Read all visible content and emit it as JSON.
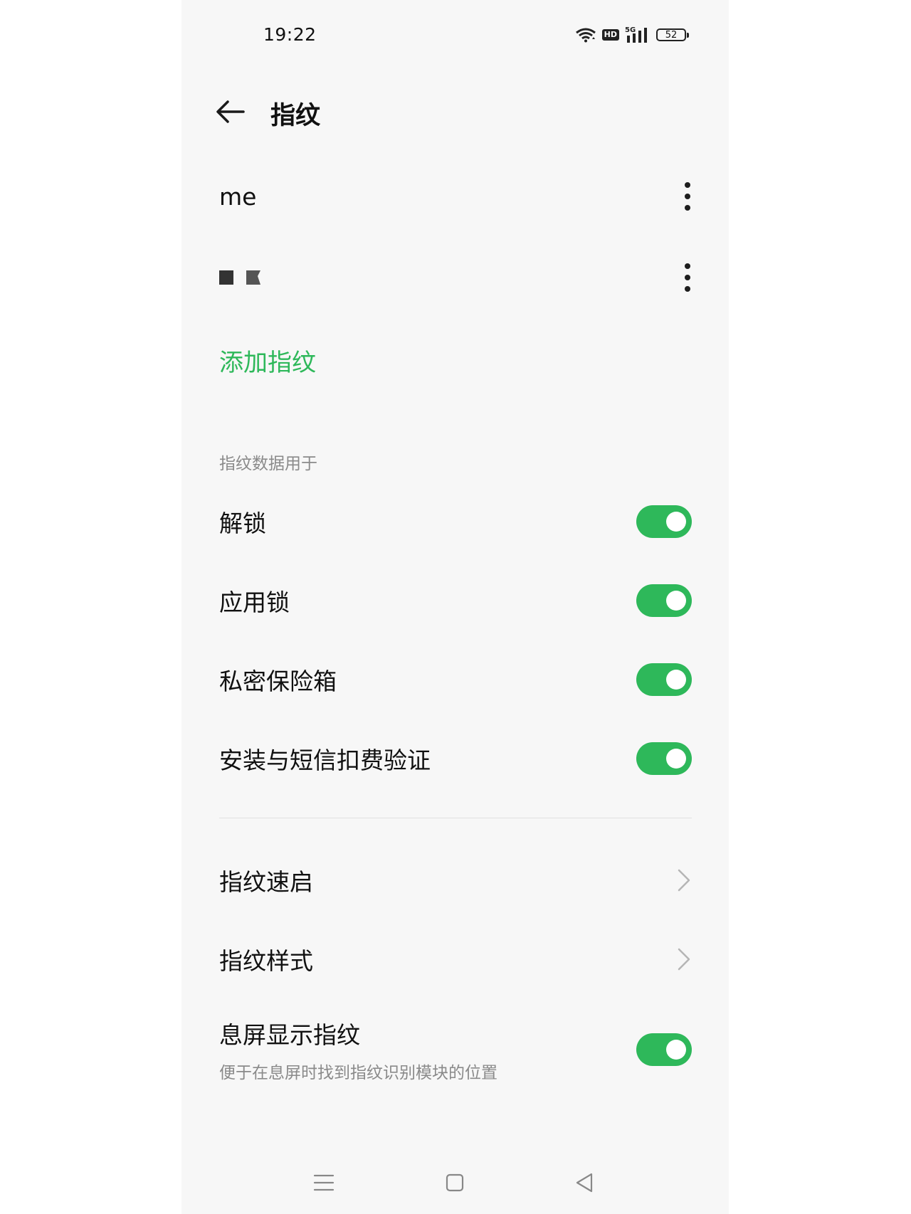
{
  "status_bar": {
    "time": "19:22",
    "hd_label": "HD",
    "network_label": "5G",
    "battery_level": "52",
    "icons": [
      "wifi-icon",
      "hd-icon",
      "signal-5g-icon",
      "battery-icon"
    ]
  },
  "header": {
    "title": "指纹",
    "back_icon": "arrow-left-icon"
  },
  "fingerprints": [
    {
      "name": "me",
      "menu_icon": "more-vertical-icon"
    },
    {
      "name": "",
      "masked": true,
      "menu_icon": "more-vertical-icon"
    }
  ],
  "add_fingerprint_label": "添加指纹",
  "usage_section": {
    "header": "指纹数据用于",
    "items": [
      {
        "label": "解锁",
        "enabled": true
      },
      {
        "label": "应用锁",
        "enabled": true
      },
      {
        "label": "私密保险箱",
        "enabled": true
      },
      {
        "label": "安装与短信扣费验证",
        "enabled": true
      }
    ]
  },
  "more_settings": {
    "quick_launch_label": "指纹速启",
    "style_label": "指纹样式",
    "screen_off_label": "息屏显示指纹",
    "screen_off_desc": "便于在息屏时找到指纹识别模块的位置",
    "screen_off_enabled": true
  },
  "nav_bar": {
    "items": [
      "menu-icon",
      "home-icon",
      "back-triangle-icon"
    ]
  },
  "colors": {
    "accent": "#2eb85a",
    "background": "#f7f7f7",
    "text_primary": "#111111",
    "text_secondary": "#8a8a8a"
  }
}
